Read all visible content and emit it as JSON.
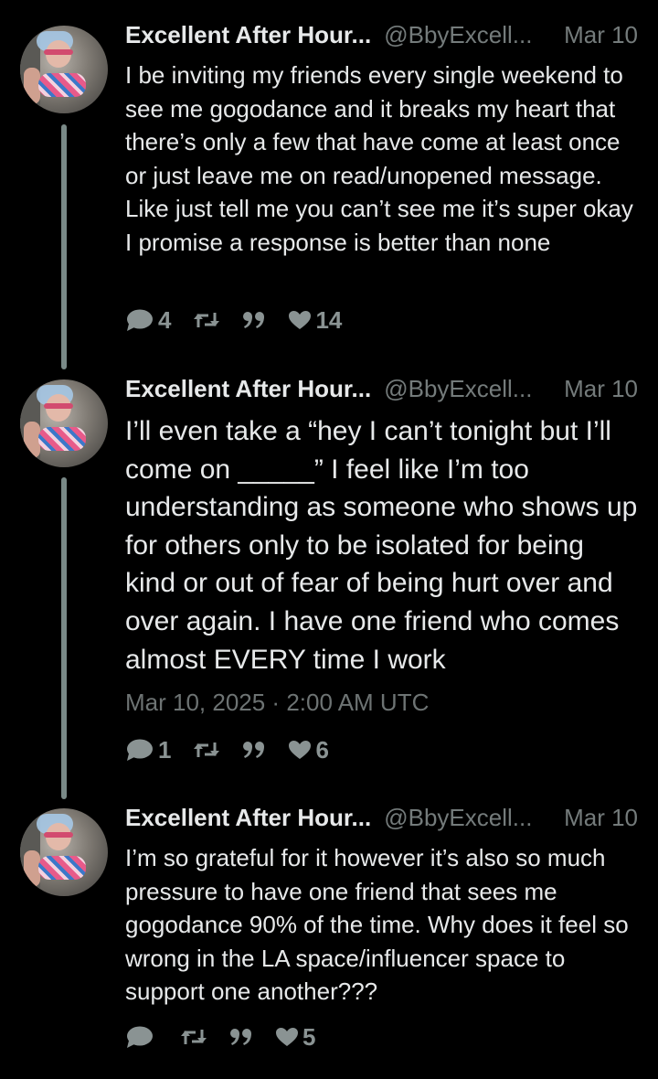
{
  "author": {
    "display_name": "Excellent After Hour...",
    "handle": "@BbyExcell..."
  },
  "tweets": [
    {
      "date": "Mar 10",
      "text": "I be inviting my friends every single weekend to see me gogodance and it breaks my heart that there’s only a few that have come at least once or just leave me on read/unopened message. Like just tell me you can’t see me it’s super okay I promise a response is better than none",
      "replies": "4",
      "likes": "14"
    },
    {
      "date": "Mar 10",
      "text": "I’ll even take a “hey I can’t tonight but I’ll come on _____” I feel like I’m too understanding as someone who shows up for others only to be isolated for being kind or out of fear of being hurt over and over again. I have one friend who comes almost EVERY time I work",
      "full_timestamp": "Mar 10, 2025 · 2:00 AM UTC",
      "replies": "1",
      "likes": "6"
    },
    {
      "date": "Mar 10",
      "text": "I’m so grateful for it however it’s also so much pressure to have one friend that sees me gogodance 90% of the time. Why does it feel so wrong in the LA space/influencer space to support one another???",
      "replies": "",
      "likes": "5"
    }
  ],
  "icons": {
    "reply": "reply-bubble-icon",
    "retweet": "retweet-icon",
    "quote": "quote-icon",
    "like": "heart-icon"
  },
  "colors": {
    "background": "#000000",
    "text": "#e7e9ea",
    "muted": "#747b7b",
    "thread_line": "#7a8a88"
  }
}
